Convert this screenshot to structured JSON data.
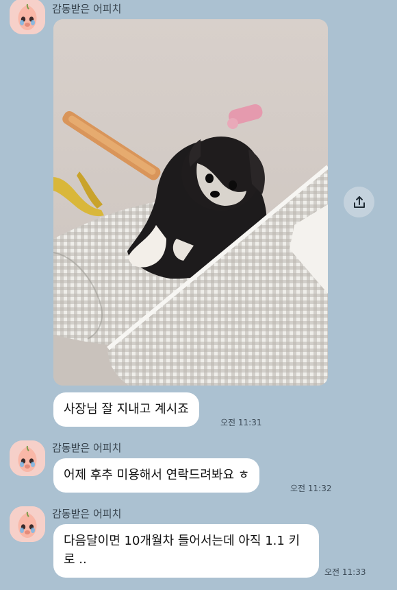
{
  "sender_name": "감동받은 어피치",
  "messages": [
    {
      "type": "photo",
      "content_icon": "dog-photo"
    },
    {
      "type": "text",
      "text": "사장님 잘 지내고 계시죠",
      "time": "오전 11:31"
    },
    {
      "type": "text",
      "text": "어제 후추 미용해서 연락드려봐요 ㅎ",
      "time": "오전 11:32"
    },
    {
      "type": "text",
      "text": "다음달이면 10개월차 들어서는데 아직 1.1 키로 ..",
      "time": "오전 11:33"
    }
  ],
  "colors": {
    "chat_background": "#abc1d1",
    "bubble": "#ffffff",
    "avatar": "#f6d0c9"
  },
  "icons": {
    "share": "share-icon",
    "avatar": "apeach-avatar-icon"
  }
}
